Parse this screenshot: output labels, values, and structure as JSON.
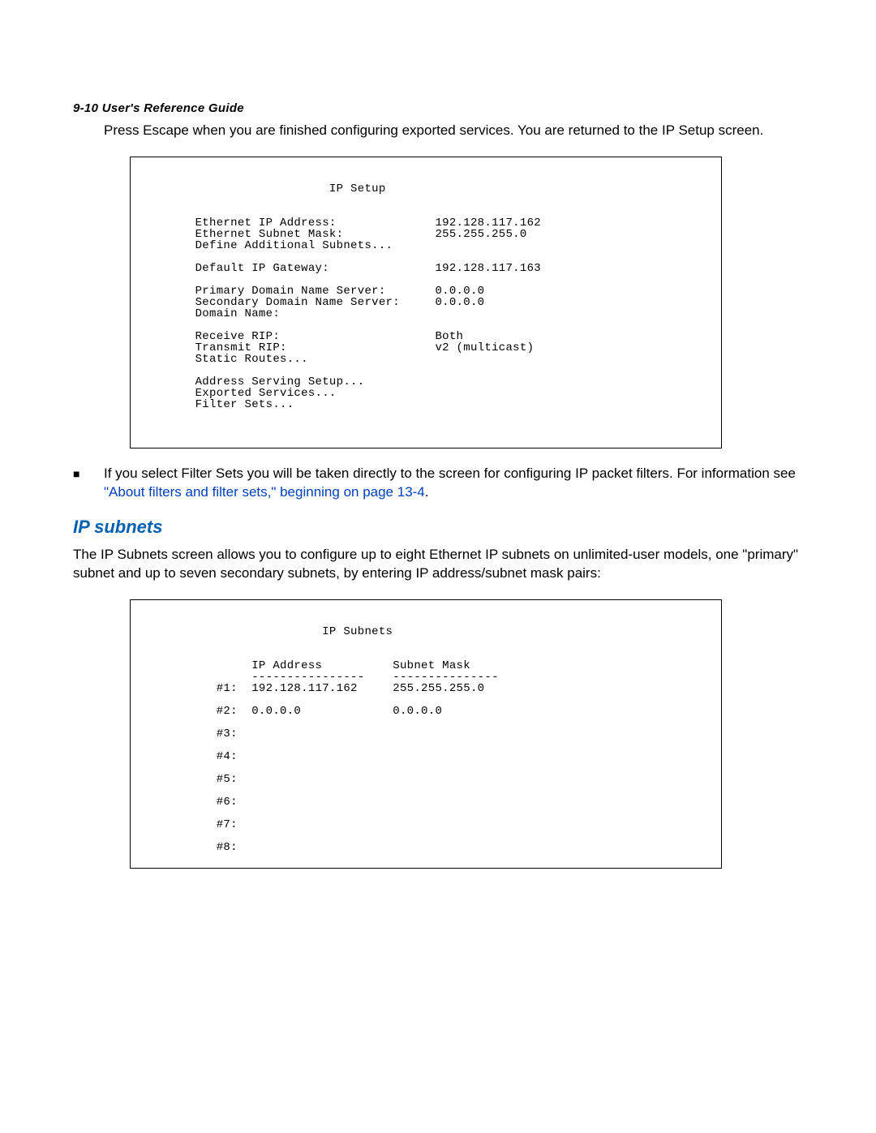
{
  "header": "9-10   User's Reference Guide",
  "intro_para": "Press Escape when you are finished configuring exported services. You are returned to the IP Setup screen.",
  "term1": {
    "title": "IP Setup",
    "rows": [
      {
        "label": "Ethernet IP Address:",
        "value": "192.128.117.162"
      },
      {
        "label": "Ethernet Subnet Mask:",
        "value": "255.255.255.0"
      },
      {
        "label": "Define Additional Subnets...",
        "value": ""
      },
      {
        "blank": true
      },
      {
        "label": "Default IP Gateway:",
        "value": "192.128.117.163"
      },
      {
        "blank": true
      },
      {
        "label": "Primary Domain Name Server:",
        "value": "0.0.0.0"
      },
      {
        "label": "Secondary Domain Name Server:",
        "value": "0.0.0.0"
      },
      {
        "label": "Domain Name:",
        "value": ""
      },
      {
        "blank": true
      },
      {
        "label": "Receive RIP:",
        "value": "Both"
      },
      {
        "label": "Transmit RIP:",
        "value": "v2 (multicast)"
      },
      {
        "label": "Static Routes...",
        "value": ""
      },
      {
        "blank": true
      },
      {
        "label": "Address Serving Setup...",
        "value": ""
      },
      {
        "label": "Exported Services...",
        "value": ""
      },
      {
        "label": "Filter Sets...",
        "value": ""
      }
    ]
  },
  "bullet1_pre": "If you select Filter Sets you will be taken directly to the screen for configuring IP packet filters. For information see ",
  "bullet1_link": "\"About filters and filter sets,\" beginning on page 13-4",
  "bullet1_post": ".",
  "section_head": "IP subnets",
  "subnet_para": "The IP Subnets screen allows you to configure up to eight Ethernet IP subnets on unlimited-user models, one \"primary\" subnet and up to seven secondary subnets, by entering IP address/subnet mask pairs:",
  "term2": {
    "title": "IP Subnets",
    "col1": "IP Address",
    "col2": "Subnet Mask",
    "rows": [
      {
        "n": "#1:",
        "ip": "192.128.117.162",
        "mask": "255.255.255.0"
      },
      {
        "n": "#2:",
        "ip": "0.0.0.0",
        "mask": "0.0.0.0"
      },
      {
        "n": "#3:",
        "ip": "",
        "mask": ""
      },
      {
        "n": "#4:",
        "ip": "",
        "mask": ""
      },
      {
        "n": "#5:",
        "ip": "",
        "mask": ""
      },
      {
        "n": "#6:",
        "ip": "",
        "mask": ""
      },
      {
        "n": "#7:",
        "ip": "",
        "mask": ""
      },
      {
        "n": "#8:",
        "ip": "",
        "mask": ""
      }
    ]
  }
}
